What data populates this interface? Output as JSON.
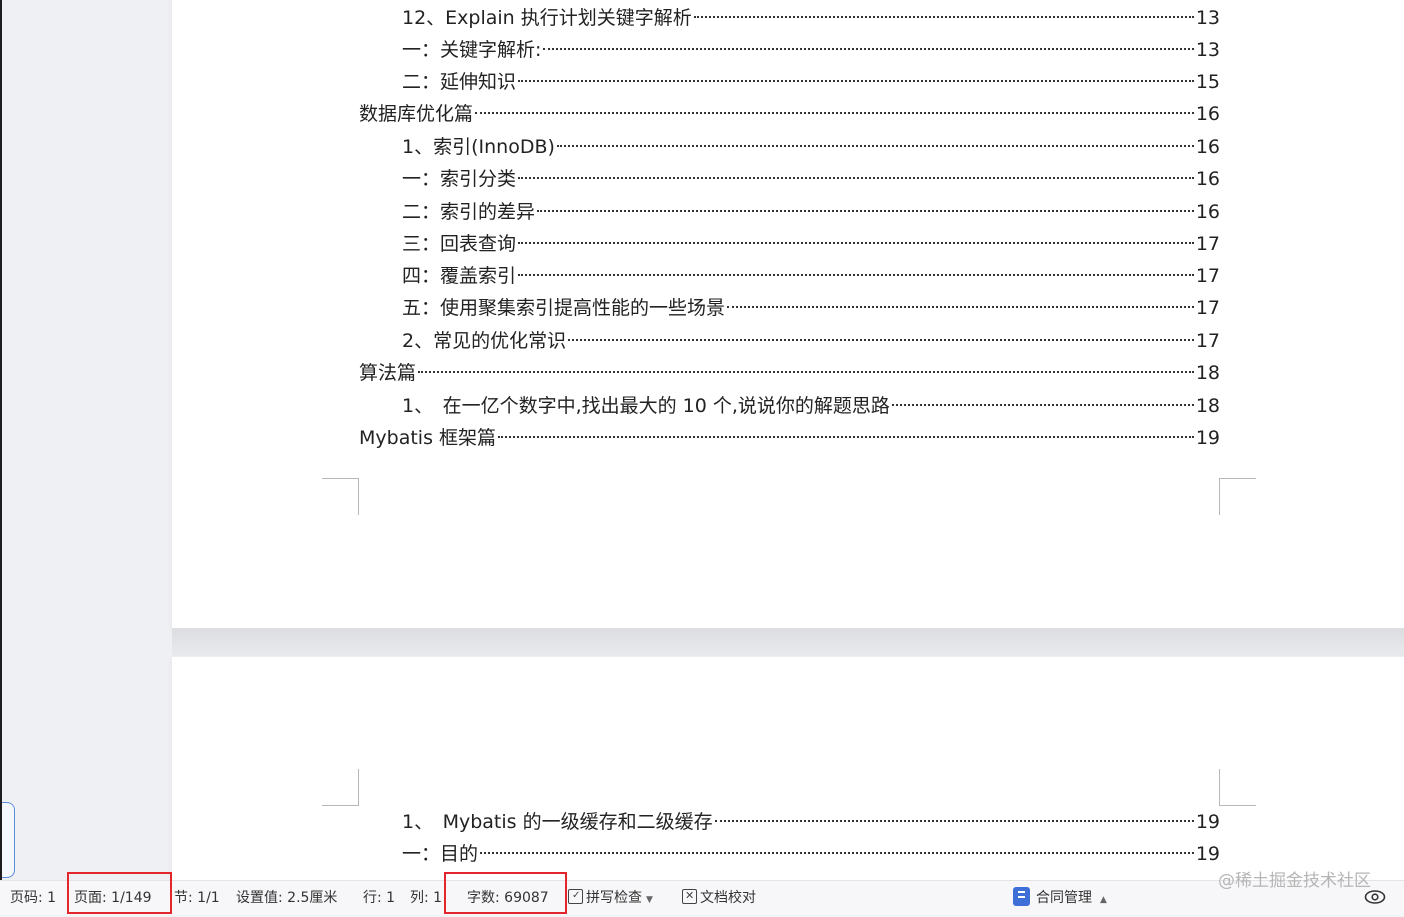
{
  "toc_page1": [
    {
      "text": "12、Explain 执行计划关键字解析",
      "page": "13",
      "level": 2
    },
    {
      "text": "一：关键字解析:",
      "page": "13",
      "level": 2
    },
    {
      "text": "二：延伸知识",
      "page": "15",
      "level": 2
    },
    {
      "text": "数据库优化篇",
      "page": "16",
      "level": 1
    },
    {
      "text": "1、索引(InnoDB)",
      "page": "16",
      "level": 2
    },
    {
      "text": "一：索引分类",
      "page": "16",
      "level": 2
    },
    {
      "text": "二：索引的差异",
      "page": "16",
      "level": 2
    },
    {
      "text": "三：回表查询",
      "page": "17",
      "level": 2
    },
    {
      "text": "四：覆盖索引",
      "page": "17",
      "level": 2
    },
    {
      "text": "五：使用聚集索引提高性能的一些场景",
      "page": "17",
      "level": 2
    },
    {
      "text": "2、常见的优化常识",
      "page": "17",
      "level": 2
    },
    {
      "text": "算法篇",
      "page": "18",
      "level": 1
    },
    {
      "text": "1、　在一亿个数字中,找出最大的 10 个,说说你的解题思路",
      "page": "18",
      "level": 2
    },
    {
      "text": "Mybatis 框架篇",
      "page": "19",
      "level": 1
    }
  ],
  "toc_page2": [
    {
      "text": "1、　Mybatis 的一级缓存和二级缓存",
      "page": "19",
      "level": 2
    },
    {
      "text": "一：目的",
      "page": "19",
      "level": 2
    }
  ],
  "status_bar": {
    "page_code": "页码: 1",
    "page": "页面: 1/149",
    "section": "节: 1/1",
    "setting": "设置值: 2.5厘米",
    "row": "行: 1",
    "col": "列: 1",
    "word_count": "字数: 69087",
    "spell_check": "拼写检查",
    "doc_proof": "文档校对",
    "contract": "合同管理"
  },
  "icons": {
    "spell_check": "spellcheck-icon",
    "doc_proof": "doc-proof-icon",
    "contract": "contract-icon",
    "eye": "eye-icon"
  },
  "colors": {
    "highlight_box": "#e2262b",
    "contract_icon": "#3d6fd6"
  },
  "watermark": "@稀土掘金技术社区"
}
